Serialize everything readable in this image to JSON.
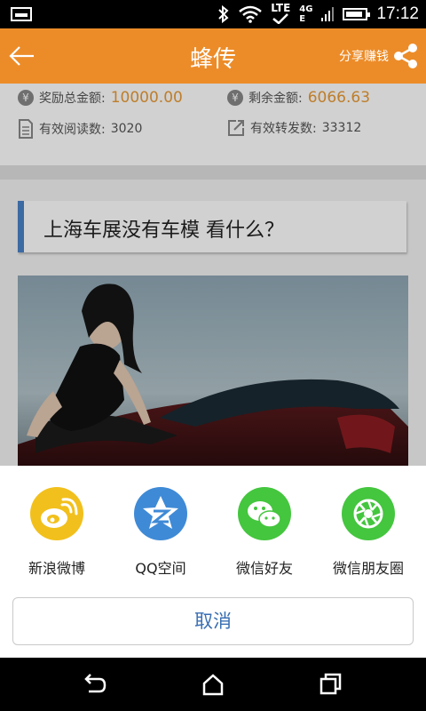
{
  "status_bar": {
    "network": "LTE",
    "signal_label": "4G",
    "signal_sub": "E",
    "time": "17:12"
  },
  "header": {
    "title": "蜂传",
    "share_label": "分享赚钱"
  },
  "stats": {
    "total_reward_label": "奖励总金额:",
    "total_reward_value": "10000.00",
    "remaining_label": "剩余金额:",
    "remaining_value": "6066.63",
    "reads_label": "有效阅读数:",
    "reads_value": "3020",
    "forwards_label": "有效转发数:",
    "forwards_value": "33312",
    "coin_symbol": "¥"
  },
  "article": {
    "headline": "上海车展没有车模   看什么？"
  },
  "share_sheet": {
    "items": [
      {
        "label": "新浪微博",
        "icon": "weibo-icon",
        "color": "#f2c01c"
      },
      {
        "label": "QQ空间",
        "icon": "qzone-icon",
        "color": "#3f8ad6"
      },
      {
        "label": "微信好友",
        "icon": "wechat-icon",
        "color": "#44c63e"
      },
      {
        "label": "微信朋友圈",
        "icon": "moments-icon",
        "color": "#44c63e"
      }
    ],
    "cancel_label": "取消"
  },
  "colors": {
    "header": "#ec8c29",
    "accent_value": "#e89a35",
    "cancel_text": "#3a6fb3"
  }
}
